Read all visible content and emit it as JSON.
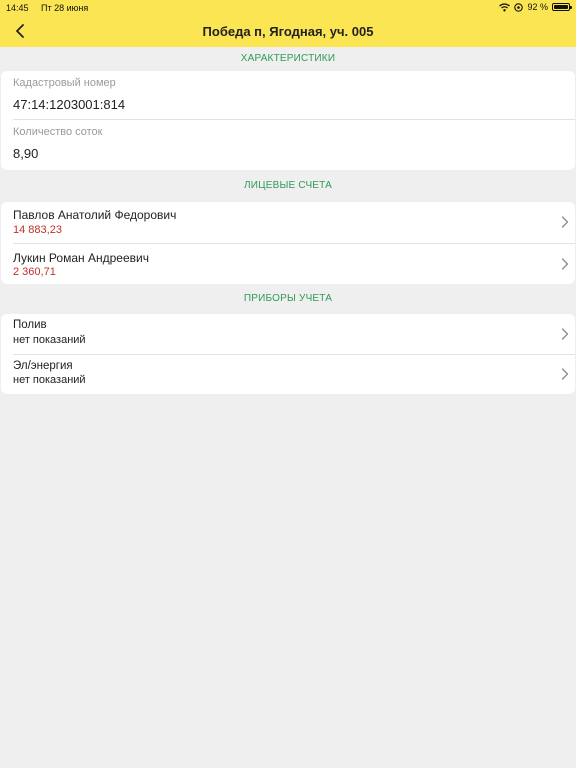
{
  "status_bar": {
    "time": "14:45",
    "date": "Пт 28 июня",
    "battery": "92 %"
  },
  "nav": {
    "title": "Победа п, Ягодная, уч. 005",
    "back_icon": "chevron-left-icon"
  },
  "sections": {
    "characteristics": "ХАРАКТЕРИСТИКИ",
    "accounts": "ЛИЦЕВЫЕ СЧЕТА",
    "meters": "ПРИБОРЫ УЧЕТА"
  },
  "characteristics": {
    "cadastral_label": "Кадастровый номер",
    "cadastral_value": "47:14:1203001:814",
    "area_label": "Количество соток",
    "area_value": "8,90"
  },
  "accounts": [
    {
      "name": "Павлов Анатолий Федорович",
      "amount": "14 883,23"
    },
    {
      "name": "Лукин Роман Андреевич",
      "amount": "2 360,71"
    }
  ],
  "meters": [
    {
      "name": "Полив",
      "status": "нет показаний"
    },
    {
      "name": "Эл/энергия",
      "status": "нет показаний"
    }
  ],
  "colors": {
    "header": "#fbe552",
    "section_title": "#2f9b55",
    "amount": "#c0302a",
    "background": "#efefef"
  }
}
